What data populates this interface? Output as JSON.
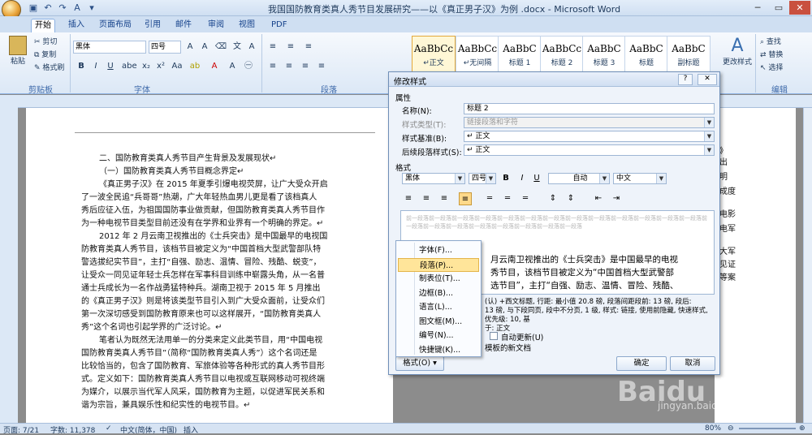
{
  "window": {
    "title": "我国国防教育类真人秀节目发展研究——以《真正男子汉》为例 .docx - Microsoft Word"
  },
  "ribbon": {
    "tabs": [
      "开始",
      "插入",
      "页面布局",
      "引用",
      "邮件",
      "审阅",
      "视图",
      "PDF"
    ],
    "active_tab": "开始",
    "clipboard": {
      "paste": "粘贴",
      "cut": "剪切",
      "copy": "复制",
      "format_painter": "格式刷",
      "label": "剪贴板"
    },
    "font": {
      "name": "黑体",
      "size": "四号",
      "label": "字体"
    },
    "paragraph": {
      "label": "段落"
    },
    "styles": [
      {
        "preview": "AaBbCc",
        "name": "↵正文"
      },
      {
        "preview": "AaBbCc",
        "name": "↵无间隔"
      },
      {
        "preview": "AaBbC",
        "name": "标题 1"
      },
      {
        "preview": "AaBbCc",
        "name": "标题 2"
      },
      {
        "preview": "AaBbC",
        "name": "标题 3"
      },
      {
        "preview": "AaBbC",
        "name": "标题"
      },
      {
        "preview": "AaBbC",
        "name": "副标题"
      }
    ],
    "change_styles": "更改样式",
    "editing": {
      "find": "查找",
      "replace": "替换",
      "select": "选择",
      "label": "编辑"
    }
  },
  "document": {
    "lines": [
      "二、国防教育类真人秀节目产生背景及发展现状↵",
      "（一）国防教育类真人秀节目概念界定↵",
      "《真正男子汉》在 2015 年夏季引爆电视荧屏，让广大受众开启",
      "了一波全民追“兵哥哥”热潮，广大年轻热血男儿更是看了该档真人",
      "秀后应征入伍，为祖国国防事业做贡献，但国防教育类真人秀节目作",
      "为一种电视节目类型目前还没有在学界和业界有一个明确的界定。↵",
      "2012 年 2 月云南卫视推出的《士兵突击》是中国最早的电视国",
      "防教育类真人秀节目，该档节目被定义为“中国首档大型武警部队特",
      "警选拔纪实节目”，主打“自强、励志、温情、冒险、残酷、蜕变”，",
      "让受众一同见证年轻士兵怎样在军事科目训练中崭露头角，从一名普",
      "通士兵成长为一名作战勇猛特种兵。湖南卫视于 2015 年 5 月推出",
      "的《真正男子汉》则是将该类型节目引入到广大受众面前，让受众们",
      "第一次深切感受到国防教育原来也可以这样展开，“国防教育类真人",
      "秀”这个名词也引起学界的广泛讨论。↵",
      "笔者认为既然无法用单一的分类来定义此类节目，用“中国电视",
      "国防教育类真人秀节目”（简称“国防教育类真人秀”）这个名词还是",
      "比较恰当的，包含了国防教育、军旅体验等各种形式的真人秀节目形",
      "式。定义如下：国防教育类真人秀节目以电视或互联网移动可视终端",
      "为媒介，以展示当代军人风采，国防教育为主题，以促进军民关系和",
      "谐为宗旨，兼具娱乐性和纪实性的电视节目。↵"
    ],
    "right_fragments": [
      "》",
      "出",
      "明",
      "成度",
      "电影",
      "电军",
      "大军",
      "见证",
      "等案"
    ]
  },
  "dialog": {
    "title": "修改样式",
    "help": "?",
    "close": "✕",
    "section_props": "属性",
    "name_label": "名称(N):",
    "name_value": "标题 2",
    "type_label": "样式类型(T):",
    "type_value": "链接段落和字符",
    "based_label": "样式基准(B):",
    "based_value": "↵ 正文",
    "next_label": "后续段落样式(S):",
    "next_value": "↵ 正文",
    "section_format": "格式",
    "font_value": "黑体",
    "size_value": "四号",
    "bold": "B",
    "italic": "I",
    "underline": "U",
    "color_value": "自动",
    "lang_value": "中文",
    "preview_prev": "前一段落前一段落前一段落前一段落前一段落前一段落前一段落前一段落前一段落前一段落前一段落前一段落前一段落前一段落前一段落前一段落前一段落前一段落前一段落前一段落前一段落",
    "preview_lines": [
      "月云南卫视推出的《士兵突击》是中国最早的电视",
      "秀节目，该档节目被定义为“中国首档大型武警部",
      "选节目”，主打“自强、励志、温情、冒险、残酷、"
    ],
    "desc_lines": [
      "(认) +西文标题, 行距: 最小值 20.8 磅, 段落间距段前: 13 磅, 段后:",
      "13 磅, 与下段同页, 段中不分页, 1 级, 样式: 链接, 使用前隐藏, 快速样式, 优先级: 10, 基",
      "于: 正文"
    ],
    "auto_update": "自动更新(U)",
    "template_text": "模板的新文档",
    "format_btn": "格式(O) ▾",
    "ok": "确定",
    "cancel": "取消"
  },
  "format_menu": [
    "字体(F)...",
    "段落(P)...",
    "制表位(T)...",
    "边框(B)...",
    "语言(L)...",
    "图文框(M)...",
    "编号(N)...",
    "快捷键(K)..."
  ],
  "format_menu_highlight": 1,
  "status": {
    "page": "页面: 7/21",
    "words": "字数: 11,378",
    "language": "中文(简体，中国)",
    "mode": "插入",
    "zoom": "80%"
  },
  "watermark": {
    "brand": "Baidu 经验",
    "url": "jingyan.baidu.com"
  }
}
